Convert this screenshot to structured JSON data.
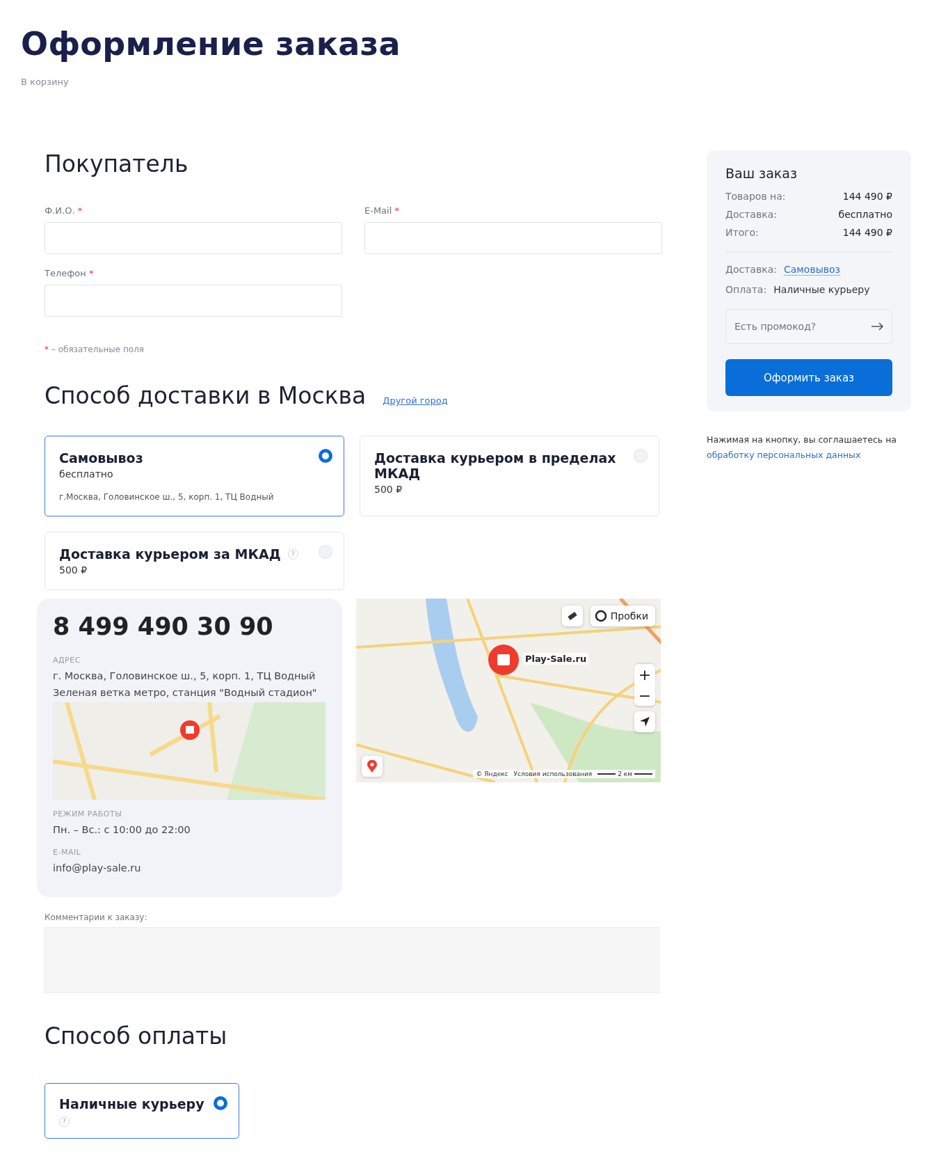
{
  "page": {
    "title": "Оформление заказа",
    "back_link": "В корзину"
  },
  "buyer": {
    "heading": "Покупатель",
    "required_mark": "*",
    "fields": [
      {
        "label": "Ф.И.О.",
        "required": true
      },
      {
        "label": "E-Mail",
        "required": true
      },
      {
        "label": "Телефон",
        "required": true
      }
    ],
    "note": "– обязательные поля"
  },
  "delivery": {
    "heading": "Способ доставки в Москва",
    "city_link": "Другой город",
    "options": [
      {
        "title": "Самовывоз",
        "price": "бесплатно",
        "address": "г.Москва, Головинское ш., 5, корп. 1, ТЦ Водный",
        "selected": true
      },
      {
        "title": "Доставка курьером в пределах МКАД",
        "price": "500 ₽",
        "selected": false
      },
      {
        "title": "Доставка курьером за МКАД",
        "hint": "?",
        "price": "500 ₽",
        "selected": false
      }
    ],
    "pickup": {
      "phone": "8 499 490 30 90",
      "address_label": "АДРЕС",
      "address": "г. Москва, Головинское ш., 5, корп. 1, ТЦ Водный",
      "metro": "Зеленая ветка метро, станция \"Водный стадион\"",
      "hours_label": "РЕЖИМ РАБОТЫ",
      "hours": "Пн. – Вс.: с 10:00 до 22:00",
      "email_label": "E-MAIL",
      "email": "info@play-sale.ru"
    },
    "map": {
      "traffic_button": "Пробки",
      "zoom_in": "+",
      "zoom_out": "−",
      "place_label": "Play-Sale.ru",
      "copyright": "© Яндекс",
      "terms_link": "Условия использования",
      "scale": "2 км"
    }
  },
  "comment": {
    "label": "Комментарии к заказу:"
  },
  "payment": {
    "heading": "Способ оплаты",
    "options": [
      {
        "title": "Наличные курьеру",
        "hint": "?",
        "selected": true
      }
    ]
  },
  "summary": {
    "heading": "Ваш заказ",
    "rows": [
      {
        "label": "Товаров на:",
        "value": "144 490 ₽"
      },
      {
        "label": "Доставка:",
        "value": "бесплатно"
      },
      {
        "label": "Итого:",
        "value": "144 490 ₽"
      }
    ],
    "details": [
      {
        "label": "Доставка:",
        "value": "Самовывоз",
        "kind": "link"
      },
      {
        "label": "Оплата:",
        "value": "Наличные курьеру",
        "kind": "text"
      }
    ],
    "promo_placeholder": "Есть промокод?",
    "submit": "Оформить заказ",
    "consent": "Нажимая на кнопку, вы соглашаетесь на",
    "consent_link": "обработку персональных данных"
  }
}
